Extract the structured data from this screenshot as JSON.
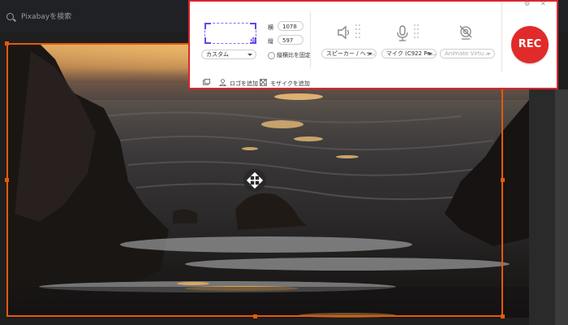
{
  "browser": {
    "search_placeholder": "Pixabayを検索"
  },
  "recorder": {
    "width_label": "横",
    "width_value": "1078",
    "height_label": "縦",
    "height_value": "597",
    "preset": "カスタム",
    "lock_ratio_label": "縦横比を固定",
    "speaker_select": "スピーカー / ヘッ...",
    "mic_select": "マイク (C922 Pe...",
    "camera_select": "Animate Virtu...",
    "add_logo_label": "ロゴを追加",
    "add_mosaic_label": "モザイクを追加",
    "rec_label": "REC",
    "accent_color": "#e12b2b",
    "icons": [
      "crop-region-icon",
      "move-icon",
      "speaker-icon",
      "microphone-icon",
      "webcam-off-icon",
      "image-icon",
      "logo-person-icon",
      "mosaic-icon",
      "close-icon"
    ]
  },
  "selection": {
    "frame_color": "#e8590c"
  }
}
